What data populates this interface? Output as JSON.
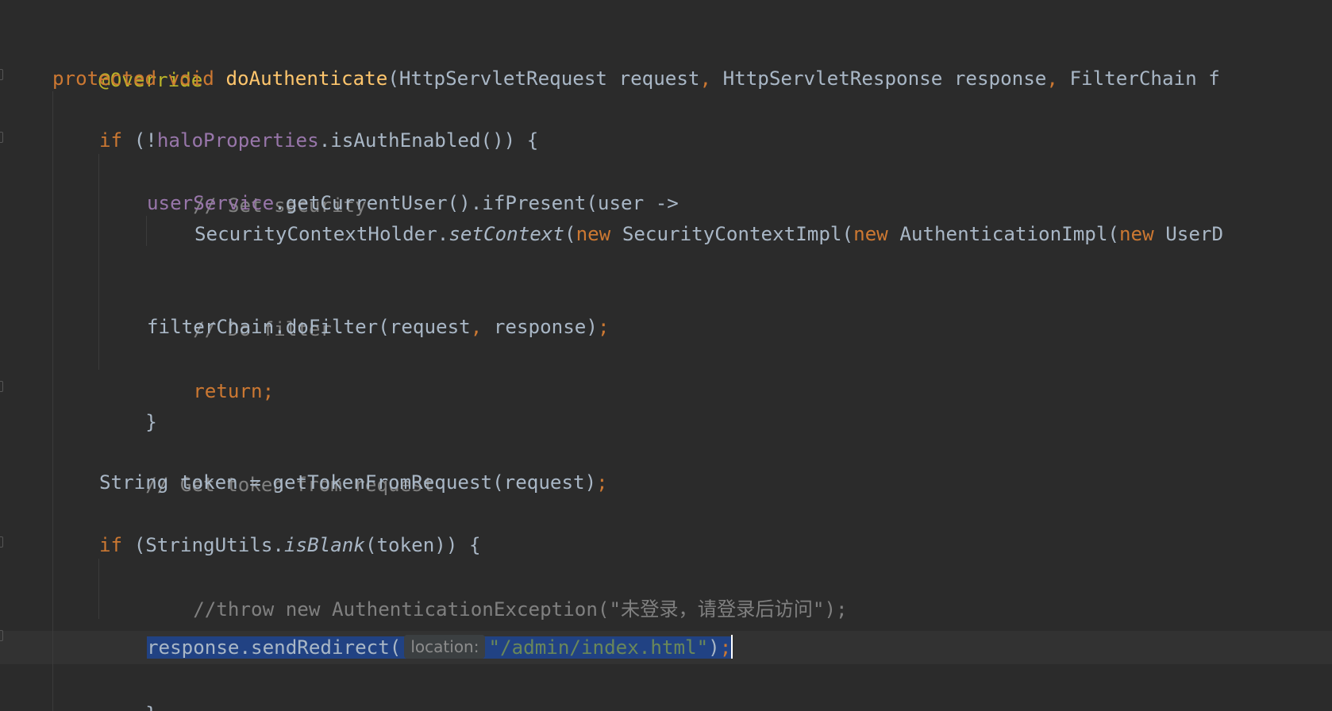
{
  "editor": {
    "lines": {
      "l1_annotation": "@Override",
      "l2_protected": "protected",
      "l2_void": "void",
      "l2_method": "doAuthenticate",
      "l2_paren": "(",
      "l2_type1": "HttpServletRequest",
      "l2_param1": "request",
      "l2_comma1": ",",
      "l2_type2": "HttpServletResponse",
      "l2_param2": "response",
      "l2_comma2": ",",
      "l2_type3": "FilterChain",
      "l2_tail": "f",
      "l3_if": "if",
      "l3_open": "(!",
      "l3_field": "haloProperties",
      "l3_call": ".isAuthEnabled()) {",
      "l4_comment": "// Set security",
      "l5_field": "userService",
      "l5_call": ".getCurrentUser().ifPresent(user ->",
      "l6_class": "SecurityContextHolder.",
      "l6_static": "setContext",
      "l6_paren": "(",
      "l6_new1": "new",
      "l6_impl1": "SecurityContextImpl(",
      "l6_new2": "new",
      "l6_impl2": "AuthenticationImpl(",
      "l6_new3": "new",
      "l6_tail": "UserD",
      "l7_comment": "// Do filter",
      "l8_call": "filterChain.doFilter(request",
      "l8_comma": ",",
      "l8_rest": "response)",
      "l8_semi": ";",
      "l9_return": "return;",
      "l10_brace": "}",
      "l11_comment": "// Get token from request",
      "l12_code": "String token = getTokenFromRequest(request)",
      "l12_semi": ";",
      "l13_if": "if",
      "l13_open": "(StringUtils.",
      "l13_static": "isBlank",
      "l13_rest": "(token)) {",
      "l14_comment": "//throw new AuthenticationException(\"未登录，请登录后访问\");",
      "l15_call": "response.sendRedirect(",
      "l15_hint": "location:",
      "l15_string": "\"/admin/index.html\"",
      "l15_close": ")",
      "l15_semi": ";",
      "l16_brace": "}"
    }
  },
  "colors": {
    "background": "#2b2b2b",
    "keyword": "#cc7832",
    "annotation": "#bbb529",
    "method_declaration": "#ffc66d",
    "field": "#9876aa",
    "comment": "#808080",
    "string": "#6a8759",
    "default_text": "#a9b7c6",
    "selection": "#214283",
    "current_line": "#323232"
  }
}
